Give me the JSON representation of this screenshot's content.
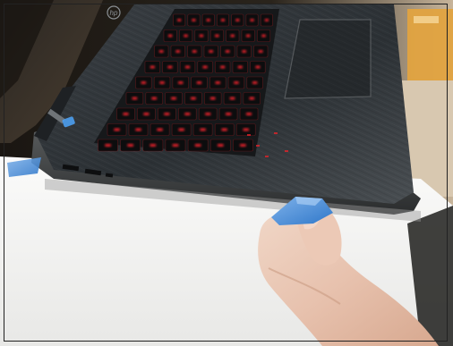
{
  "photo": {
    "subject": "laptop-keyboard-with-blue-opening-pick",
    "logo_text": "hp",
    "accent_colors": {
      "keyboard_backlight": "#e0242a",
      "pick_blue": "#3c86d6",
      "laptop_body": "#2f3438",
      "desk": "#f4f4f2"
    }
  }
}
